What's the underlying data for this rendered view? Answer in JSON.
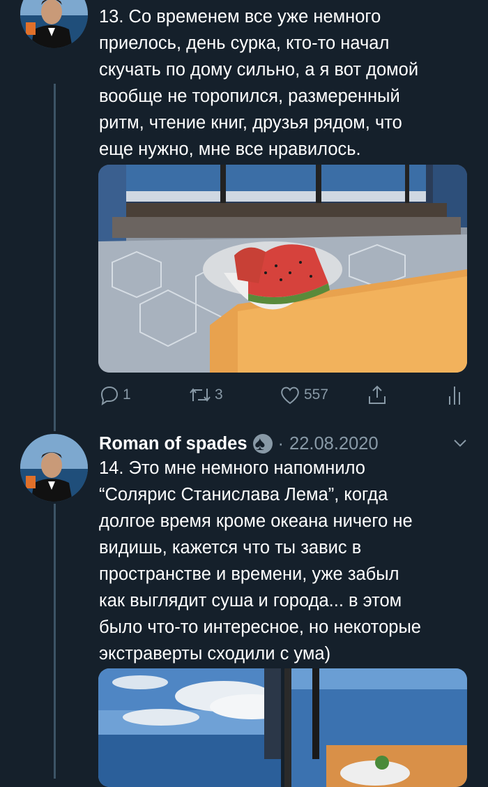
{
  "tweet13": {
    "text": "13. Со временем все уже немного\nприелось, день сурка, кто-то начал\nскучать по дому сильно, а я вот домой\nвообще не торопился, размеренный\nритм, чтение книг, друзья рядом, что\nеще нужно, мне все нравилось.",
    "image_alt": "Watermelon slices in a white bowl on a ship deck table",
    "actions": {
      "replies": "1",
      "retweets": "3",
      "likes": "557"
    }
  },
  "tweet14": {
    "author": "Roman of spades",
    "date": "22.08.2020",
    "separator": "·",
    "text": "14. Это мне немного напомнило\n“Солярис Станислава Лема”, когда\nдолгое время кроме океана ничего не\nвидишь, кажется что ты завис в\nпространстве и времени, уже забыл\nкак выглядит суша и города... в этом\nбыло что-то интересное, но некоторые\nэкстраверты сходили с ума)"
  },
  "colors": {
    "background": "#15202b",
    "secondary_text": "#8899a6",
    "thread_line": "#3d5466"
  }
}
